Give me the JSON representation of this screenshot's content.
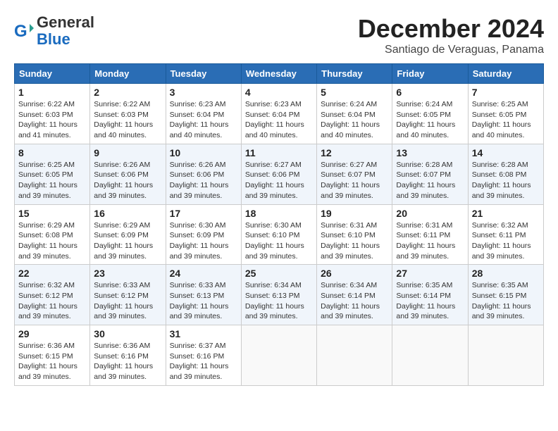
{
  "header": {
    "logo_general": "General",
    "logo_blue": "Blue",
    "month_title": "December 2024",
    "location": "Santiago de Veraguas, Panama"
  },
  "weekdays": [
    "Sunday",
    "Monday",
    "Tuesday",
    "Wednesday",
    "Thursday",
    "Friday",
    "Saturday"
  ],
  "weeks": [
    [
      {
        "day": "1",
        "sunrise": "6:22 AM",
        "sunset": "6:03 PM",
        "daylight": "11 hours and 41 minutes."
      },
      {
        "day": "2",
        "sunrise": "6:22 AM",
        "sunset": "6:03 PM",
        "daylight": "11 hours and 40 minutes."
      },
      {
        "day": "3",
        "sunrise": "6:23 AM",
        "sunset": "6:04 PM",
        "daylight": "11 hours and 40 minutes."
      },
      {
        "day": "4",
        "sunrise": "6:23 AM",
        "sunset": "6:04 PM",
        "daylight": "11 hours and 40 minutes."
      },
      {
        "day": "5",
        "sunrise": "6:24 AM",
        "sunset": "6:04 PM",
        "daylight": "11 hours and 40 minutes."
      },
      {
        "day": "6",
        "sunrise": "6:24 AM",
        "sunset": "6:05 PM",
        "daylight": "11 hours and 40 minutes."
      },
      {
        "day": "7",
        "sunrise": "6:25 AM",
        "sunset": "6:05 PM",
        "daylight": "11 hours and 40 minutes."
      }
    ],
    [
      {
        "day": "8",
        "sunrise": "6:25 AM",
        "sunset": "6:05 PM",
        "daylight": "11 hours and 39 minutes."
      },
      {
        "day": "9",
        "sunrise": "6:26 AM",
        "sunset": "6:06 PM",
        "daylight": "11 hours and 39 minutes."
      },
      {
        "day": "10",
        "sunrise": "6:26 AM",
        "sunset": "6:06 PM",
        "daylight": "11 hours and 39 minutes."
      },
      {
        "day": "11",
        "sunrise": "6:27 AM",
        "sunset": "6:06 PM",
        "daylight": "11 hours and 39 minutes."
      },
      {
        "day": "12",
        "sunrise": "6:27 AM",
        "sunset": "6:07 PM",
        "daylight": "11 hours and 39 minutes."
      },
      {
        "day": "13",
        "sunrise": "6:28 AM",
        "sunset": "6:07 PM",
        "daylight": "11 hours and 39 minutes."
      },
      {
        "day": "14",
        "sunrise": "6:28 AM",
        "sunset": "6:08 PM",
        "daylight": "11 hours and 39 minutes."
      }
    ],
    [
      {
        "day": "15",
        "sunrise": "6:29 AM",
        "sunset": "6:08 PM",
        "daylight": "11 hours and 39 minutes."
      },
      {
        "day": "16",
        "sunrise": "6:29 AM",
        "sunset": "6:09 PM",
        "daylight": "11 hours and 39 minutes."
      },
      {
        "day": "17",
        "sunrise": "6:30 AM",
        "sunset": "6:09 PM",
        "daylight": "11 hours and 39 minutes."
      },
      {
        "day": "18",
        "sunrise": "6:30 AM",
        "sunset": "6:10 PM",
        "daylight": "11 hours and 39 minutes."
      },
      {
        "day": "19",
        "sunrise": "6:31 AM",
        "sunset": "6:10 PM",
        "daylight": "11 hours and 39 minutes."
      },
      {
        "day": "20",
        "sunrise": "6:31 AM",
        "sunset": "6:11 PM",
        "daylight": "11 hours and 39 minutes."
      },
      {
        "day": "21",
        "sunrise": "6:32 AM",
        "sunset": "6:11 PM",
        "daylight": "11 hours and 39 minutes."
      }
    ],
    [
      {
        "day": "22",
        "sunrise": "6:32 AM",
        "sunset": "6:12 PM",
        "daylight": "11 hours and 39 minutes."
      },
      {
        "day": "23",
        "sunrise": "6:33 AM",
        "sunset": "6:12 PM",
        "daylight": "11 hours and 39 minutes."
      },
      {
        "day": "24",
        "sunrise": "6:33 AM",
        "sunset": "6:13 PM",
        "daylight": "11 hours and 39 minutes."
      },
      {
        "day": "25",
        "sunrise": "6:34 AM",
        "sunset": "6:13 PM",
        "daylight": "11 hours and 39 minutes."
      },
      {
        "day": "26",
        "sunrise": "6:34 AM",
        "sunset": "6:14 PM",
        "daylight": "11 hours and 39 minutes."
      },
      {
        "day": "27",
        "sunrise": "6:35 AM",
        "sunset": "6:14 PM",
        "daylight": "11 hours and 39 minutes."
      },
      {
        "day": "28",
        "sunrise": "6:35 AM",
        "sunset": "6:15 PM",
        "daylight": "11 hours and 39 minutes."
      }
    ],
    [
      {
        "day": "29",
        "sunrise": "6:36 AM",
        "sunset": "6:15 PM",
        "daylight": "11 hours and 39 minutes."
      },
      {
        "day": "30",
        "sunrise": "6:36 AM",
        "sunset": "6:16 PM",
        "daylight": "11 hours and 39 minutes."
      },
      {
        "day": "31",
        "sunrise": "6:37 AM",
        "sunset": "6:16 PM",
        "daylight": "11 hours and 39 minutes."
      },
      null,
      null,
      null,
      null
    ]
  ]
}
